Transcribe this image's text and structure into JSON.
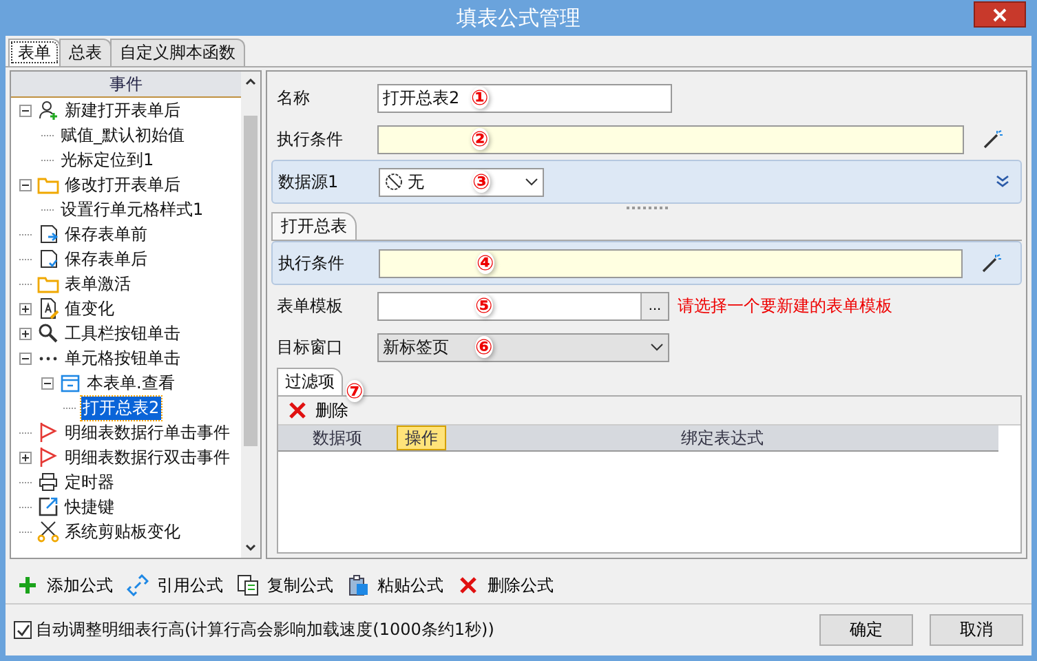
{
  "window": {
    "title": "填表公式管理"
  },
  "tabs": [
    {
      "label": "表单",
      "selected": true
    },
    {
      "label": "总表",
      "selected": false
    },
    {
      "label": "自定义脚本函数",
      "selected": false
    }
  ],
  "tree": {
    "header": "事件",
    "items": [
      {
        "label": "新建打开表单后",
        "kind": "user-add",
        "expanded": true,
        "selected": false,
        "children": [
          {
            "label": "赋值_默认初始值",
            "selected": false
          },
          {
            "label": "光标定位到1",
            "selected": false
          }
        ]
      },
      {
        "label": "修改打开表单后",
        "kind": "folder",
        "expanded": true,
        "selected": false,
        "children": [
          {
            "label": "设置行单元格样式1",
            "selected": false
          }
        ]
      },
      {
        "label": "保存表单前",
        "kind": "save-arrow",
        "selected": false
      },
      {
        "label": "保存表单后",
        "kind": "save-check",
        "selected": false
      },
      {
        "label": "表单激活",
        "kind": "folder",
        "selected": false
      },
      {
        "label": "值变化",
        "kind": "doc-pen",
        "expanded": false,
        "selected": false
      },
      {
        "label": "工具栏按钮单击",
        "kind": "search",
        "expanded": false,
        "selected": false
      },
      {
        "label": "单元格按钮单击",
        "kind": "dots",
        "expanded": true,
        "selected": false,
        "children": [
          {
            "label": "本表单.查看",
            "kind": "form",
            "expanded": true,
            "selected": false,
            "children": [
              {
                "label": "打开总表2",
                "selected": true
              }
            ]
          }
        ]
      },
      {
        "label": "明细表数据行单击事件",
        "kind": "flag",
        "selected": false
      },
      {
        "label": "明细表数据行双击事件",
        "kind": "flag",
        "expanded": false,
        "selected": false
      },
      {
        "label": "定时器",
        "kind": "printer",
        "selected": false
      },
      {
        "label": "快捷键",
        "kind": "shortcut",
        "selected": false
      },
      {
        "label": "系统剪贴板变化",
        "kind": "scissors",
        "selected": false
      }
    ]
  },
  "form": {
    "name": {
      "label": "名称",
      "value": "打开总表2",
      "marker": "①"
    },
    "condition": {
      "label": "执行条件",
      "marker": "②"
    },
    "datasource": {
      "label": "数据源1",
      "value": "无",
      "marker": "③"
    }
  },
  "action": {
    "tab": "打开总表",
    "condition": {
      "label": "执行条件",
      "marker": "④"
    },
    "template": {
      "label": "表单模板",
      "marker": "⑤",
      "browse": "...",
      "hint": "请选择一个要新建的表单模板"
    },
    "target": {
      "label": "目标窗口",
      "value": "新标签页",
      "marker": "⑥"
    },
    "filter": {
      "tab": "过滤项",
      "marker": "⑦",
      "delete": "删除",
      "columns": [
        {
          "label": "数据项",
          "selected": false
        },
        {
          "label": "操作",
          "selected": true
        },
        {
          "label": "绑定表达式",
          "selected": false
        }
      ]
    }
  },
  "toolbar": [
    {
      "kind": "add",
      "label": "添加公式"
    },
    {
      "kind": "link",
      "label": "引用公式"
    },
    {
      "kind": "copy",
      "label": "复制公式"
    },
    {
      "kind": "paste",
      "label": "粘贴公式"
    },
    {
      "kind": "delete",
      "label": "删除公式"
    }
  ],
  "auto_height": {
    "label": "自动调整明细表行高(计算行高会影响加载速度(1000条约1秒))",
    "checked": true
  },
  "buttons": [
    "确定",
    "取消"
  ]
}
